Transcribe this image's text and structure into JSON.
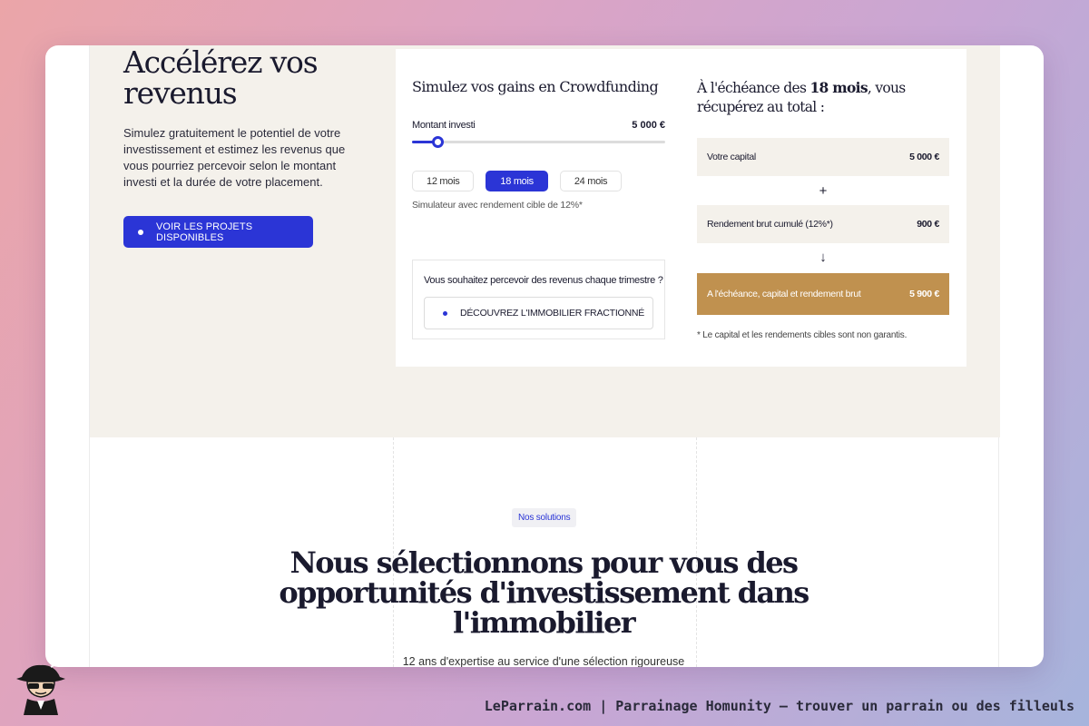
{
  "hero": {
    "title": "Accélérez vos revenus",
    "description": "Simulez gratuitement le potentiel de votre investissement et estimez les revenus que vous pourriez percevoir selon le montant investi et la durée de votre placement.",
    "cta_label": "VOIR LES PROJETS DISPONIBLES"
  },
  "simulator": {
    "title": "Simulez vos gains en Crowdfunding",
    "amount_label": "Montant investi",
    "amount_value": "5 000 €",
    "slider_fraction": 0.1,
    "durations": [
      "12 mois",
      "18 mois",
      "24 mois"
    ],
    "active_duration_index": 1,
    "note": "Simulateur avec rendement cible de 12%*",
    "quarterly_question": "Vous souhaitez percevoir des revenus chaque trimestre ?",
    "quarterly_cta": "DÉCOUVREZ L'IMMOBILIER FRACTIONNÉ"
  },
  "results": {
    "title_prefix": "À l'échéance des ",
    "title_bold": "18 mois",
    "title_suffix": ", vous récupérez au total :",
    "capital_label": "Votre capital",
    "capital_value": "5 000 €",
    "plus_sign": "+",
    "yield_label": "Rendement brut cumulé (12%*)",
    "yield_value": "900 €",
    "arrow_sign": "↓",
    "total_label": "A l'échéance, capital et rendement brut",
    "total_value": "5 900 €",
    "disclaimer": "* Le capital et les rendements cibles sont non garantis."
  },
  "solutions": {
    "tag": "Nos solutions",
    "title": "Nous sélectionnons pour vous des opportunités d'investissement dans l'immobilier",
    "subtitle": "12 ans d'expertise au service d'une sélection rigoureuse"
  },
  "footer": {
    "text": "LeParrain.com | Parrainage Homunity — trouver un parrain ou des filleuls",
    "logo_icon": "spy-mascot-icon"
  },
  "colors": {
    "accent": "#2b35d6",
    "gold": "#c0914f",
    "beige": "#f4f1eb"
  }
}
